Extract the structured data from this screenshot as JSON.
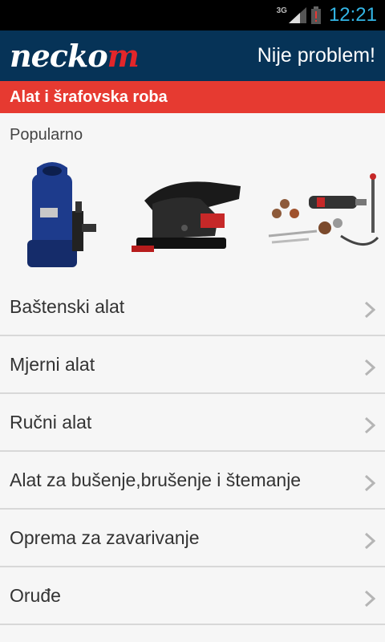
{
  "status": {
    "network": "3G",
    "time": "12:21"
  },
  "header": {
    "logo_white": "necko",
    "logo_red": "m",
    "slogan": "Nije problem!"
  },
  "category": {
    "title": "Alat i šrafovska roba"
  },
  "popular": {
    "title": "Popularno",
    "products": [
      {
        "icon": "water-pump-icon"
      },
      {
        "icon": "sander-icon"
      },
      {
        "icon": "rotary-tool-kit-icon"
      }
    ]
  },
  "menu": {
    "items": [
      {
        "label": "Baštenski alat"
      },
      {
        "label": "Mjerni alat"
      },
      {
        "label": "Ručni alat"
      },
      {
        "label": "Alat za bušenje,brušenje i štemanje"
      },
      {
        "label": "Oprema za zavarivanje"
      },
      {
        "label": "Oruđe"
      }
    ]
  }
}
